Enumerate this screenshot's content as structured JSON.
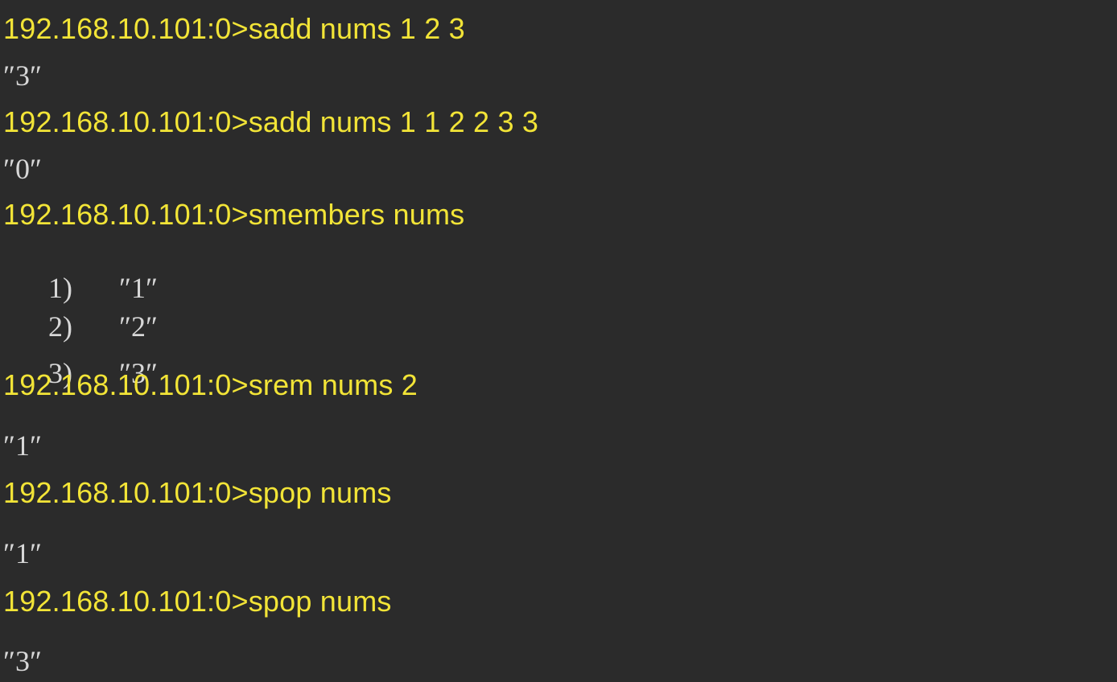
{
  "terminal": {
    "lines": [
      {
        "kind": "command",
        "text": "192.168.10.101:0>sadd nums 1 2 3"
      },
      {
        "kind": "output",
        "text": "″3″"
      },
      {
        "kind": "command",
        "text": "192.168.10.101:0>sadd nums 1 1 2 2 3 3"
      },
      {
        "kind": "output",
        "text": "″0″"
      },
      {
        "kind": "command",
        "text": "192.168.10.101:0>smembers nums"
      },
      {
        "kind": "list",
        "index": "1)",
        "value": "″1″"
      },
      {
        "kind": "list",
        "index": "2)",
        "value": "″2″"
      },
      {
        "kind": "list",
        "index": "3)",
        "value": "″3″"
      },
      {
        "kind": "command",
        "text": "192.168.10.101:0>srem nums 2"
      },
      {
        "kind": "output",
        "text": "″1″"
      },
      {
        "kind": "command",
        "text": "192.168.10.101:0>spop nums"
      },
      {
        "kind": "output",
        "text": "″1″"
      },
      {
        "kind": "command",
        "text": "192.168.10.101:0>spop nums"
      },
      {
        "kind": "output",
        "text": "″3″"
      }
    ]
  },
  "colors": {
    "background": "#2b2b2b",
    "command": "#f2e437",
    "output": "#d7d7d7"
  }
}
